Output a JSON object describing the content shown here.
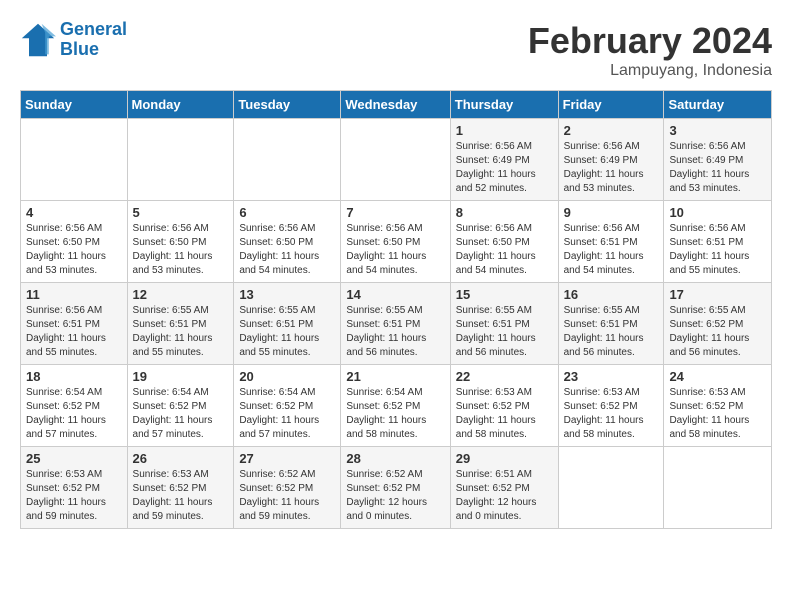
{
  "logo": {
    "line1": "General",
    "line2": "Blue"
  },
  "title": "February 2024",
  "subtitle": "Lampuyang, Indonesia",
  "days_of_week": [
    "Sunday",
    "Monday",
    "Tuesday",
    "Wednesday",
    "Thursday",
    "Friday",
    "Saturday"
  ],
  "weeks": [
    [
      {
        "day": "",
        "info": ""
      },
      {
        "day": "",
        "info": ""
      },
      {
        "day": "",
        "info": ""
      },
      {
        "day": "",
        "info": ""
      },
      {
        "day": "1",
        "info": "Sunrise: 6:56 AM\nSunset: 6:49 PM\nDaylight: 11 hours and 52 minutes."
      },
      {
        "day": "2",
        "info": "Sunrise: 6:56 AM\nSunset: 6:49 PM\nDaylight: 11 hours and 53 minutes."
      },
      {
        "day": "3",
        "info": "Sunrise: 6:56 AM\nSunset: 6:49 PM\nDaylight: 11 hours and 53 minutes."
      }
    ],
    [
      {
        "day": "4",
        "info": "Sunrise: 6:56 AM\nSunset: 6:50 PM\nDaylight: 11 hours and 53 minutes."
      },
      {
        "day": "5",
        "info": "Sunrise: 6:56 AM\nSunset: 6:50 PM\nDaylight: 11 hours and 53 minutes."
      },
      {
        "day": "6",
        "info": "Sunrise: 6:56 AM\nSunset: 6:50 PM\nDaylight: 11 hours and 54 minutes."
      },
      {
        "day": "7",
        "info": "Sunrise: 6:56 AM\nSunset: 6:50 PM\nDaylight: 11 hours and 54 minutes."
      },
      {
        "day": "8",
        "info": "Sunrise: 6:56 AM\nSunset: 6:50 PM\nDaylight: 11 hours and 54 minutes."
      },
      {
        "day": "9",
        "info": "Sunrise: 6:56 AM\nSunset: 6:51 PM\nDaylight: 11 hours and 54 minutes."
      },
      {
        "day": "10",
        "info": "Sunrise: 6:56 AM\nSunset: 6:51 PM\nDaylight: 11 hours and 55 minutes."
      }
    ],
    [
      {
        "day": "11",
        "info": "Sunrise: 6:56 AM\nSunset: 6:51 PM\nDaylight: 11 hours and 55 minutes."
      },
      {
        "day": "12",
        "info": "Sunrise: 6:55 AM\nSunset: 6:51 PM\nDaylight: 11 hours and 55 minutes."
      },
      {
        "day": "13",
        "info": "Sunrise: 6:55 AM\nSunset: 6:51 PM\nDaylight: 11 hours and 55 minutes."
      },
      {
        "day": "14",
        "info": "Sunrise: 6:55 AM\nSunset: 6:51 PM\nDaylight: 11 hours and 56 minutes."
      },
      {
        "day": "15",
        "info": "Sunrise: 6:55 AM\nSunset: 6:51 PM\nDaylight: 11 hours and 56 minutes."
      },
      {
        "day": "16",
        "info": "Sunrise: 6:55 AM\nSunset: 6:51 PM\nDaylight: 11 hours and 56 minutes."
      },
      {
        "day": "17",
        "info": "Sunrise: 6:55 AM\nSunset: 6:52 PM\nDaylight: 11 hours and 56 minutes."
      }
    ],
    [
      {
        "day": "18",
        "info": "Sunrise: 6:54 AM\nSunset: 6:52 PM\nDaylight: 11 hours and 57 minutes."
      },
      {
        "day": "19",
        "info": "Sunrise: 6:54 AM\nSunset: 6:52 PM\nDaylight: 11 hours and 57 minutes."
      },
      {
        "day": "20",
        "info": "Sunrise: 6:54 AM\nSunset: 6:52 PM\nDaylight: 11 hours and 57 minutes."
      },
      {
        "day": "21",
        "info": "Sunrise: 6:54 AM\nSunset: 6:52 PM\nDaylight: 11 hours and 58 minutes."
      },
      {
        "day": "22",
        "info": "Sunrise: 6:53 AM\nSunset: 6:52 PM\nDaylight: 11 hours and 58 minutes."
      },
      {
        "day": "23",
        "info": "Sunrise: 6:53 AM\nSunset: 6:52 PM\nDaylight: 11 hours and 58 minutes."
      },
      {
        "day": "24",
        "info": "Sunrise: 6:53 AM\nSunset: 6:52 PM\nDaylight: 11 hours and 58 minutes."
      }
    ],
    [
      {
        "day": "25",
        "info": "Sunrise: 6:53 AM\nSunset: 6:52 PM\nDaylight: 11 hours and 59 minutes."
      },
      {
        "day": "26",
        "info": "Sunrise: 6:53 AM\nSunset: 6:52 PM\nDaylight: 11 hours and 59 minutes."
      },
      {
        "day": "27",
        "info": "Sunrise: 6:52 AM\nSunset: 6:52 PM\nDaylight: 11 hours and 59 minutes."
      },
      {
        "day": "28",
        "info": "Sunrise: 6:52 AM\nSunset: 6:52 PM\nDaylight: 12 hours and 0 minutes."
      },
      {
        "day": "29",
        "info": "Sunrise: 6:51 AM\nSunset: 6:52 PM\nDaylight: 12 hours and 0 minutes."
      },
      {
        "day": "",
        "info": ""
      },
      {
        "day": "",
        "info": ""
      }
    ]
  ]
}
